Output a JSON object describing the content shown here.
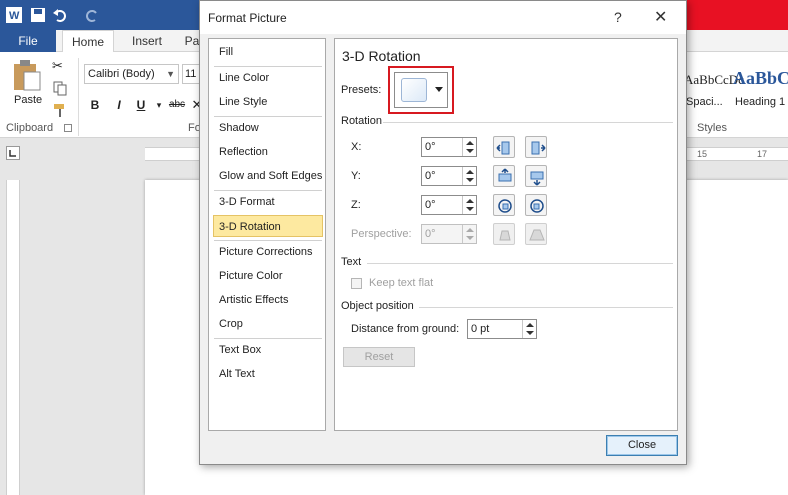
{
  "word": {
    "tabs": {
      "file": "File",
      "home": "Home",
      "insert": "Insert",
      "page_layout": "Pa"
    },
    "clipboard": {
      "paste": "Paste",
      "label": "Clipboard"
    },
    "font": {
      "name": "Calibri (Body)",
      "size": "11",
      "label": "Fo"
    },
    "styles": {
      "sample1": "AaBbCcDc",
      "sample2": "AaBbC",
      "style1": "Spaci...",
      "style2": "Heading 1",
      "label": "Styles"
    },
    "ruler": {
      "mark15": "15",
      "mark17": "17"
    },
    "colors": {
      "brand": "#2b579a",
      "red": "#e81123"
    }
  },
  "dialog": {
    "title": "Format Picture",
    "help": "?",
    "close_x": "✕",
    "nav": [
      "Fill",
      "Line Color",
      "Line Style",
      "Shadow",
      "Reflection",
      "Glow and Soft Edges",
      "3-D Format",
      "3-D Rotation",
      "Picture Corrections",
      "Picture Color",
      "Artistic Effects",
      "Crop",
      "Text Box",
      "Alt Text"
    ],
    "selected_nav": "3-D Rotation",
    "panel": {
      "title": "3-D Rotation",
      "presets_label": "Presets:",
      "rotation_label": "Rotation",
      "x_label": "X:",
      "x_value": "0°",
      "y_label": "Y:",
      "y_value": "0°",
      "z_label": "Z:",
      "z_value": "0°",
      "perspective_label": "Perspective:",
      "perspective_value": "0°",
      "text_label": "Text",
      "keep_text_flat": "Keep text flat",
      "object_position_label": "Object position",
      "distance_label": "Distance from ground:",
      "distance_value": "0 pt",
      "reset": "Reset"
    },
    "close_button": "Close",
    "colors": {
      "selection_bg": "#fde9a0",
      "highlight_red": "#d71920"
    }
  }
}
